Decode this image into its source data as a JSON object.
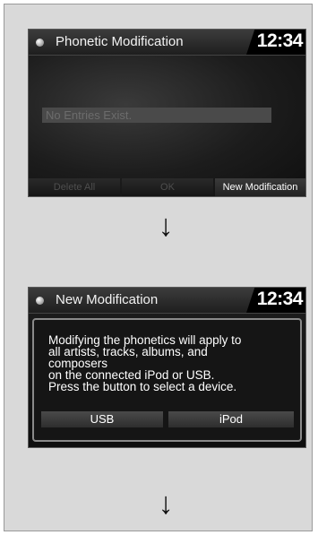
{
  "screen1": {
    "title": "Phonetic Modification",
    "clock": "12:34",
    "empty_message": "No Entries Exist.",
    "softkeys": [
      "Delete All",
      "OK",
      "New Modification"
    ]
  },
  "arrows": [
    "↓",
    "↓"
  ],
  "screen2": {
    "title": "New Modification",
    "clock": "12:34",
    "message": "Modifying the phonetics will apply to\nall artists, tracks, albums, and\ncomposers\non the connected iPod or USB.\nPress the button to select a device.",
    "buttons": [
      "USB",
      "iPod"
    ]
  }
}
